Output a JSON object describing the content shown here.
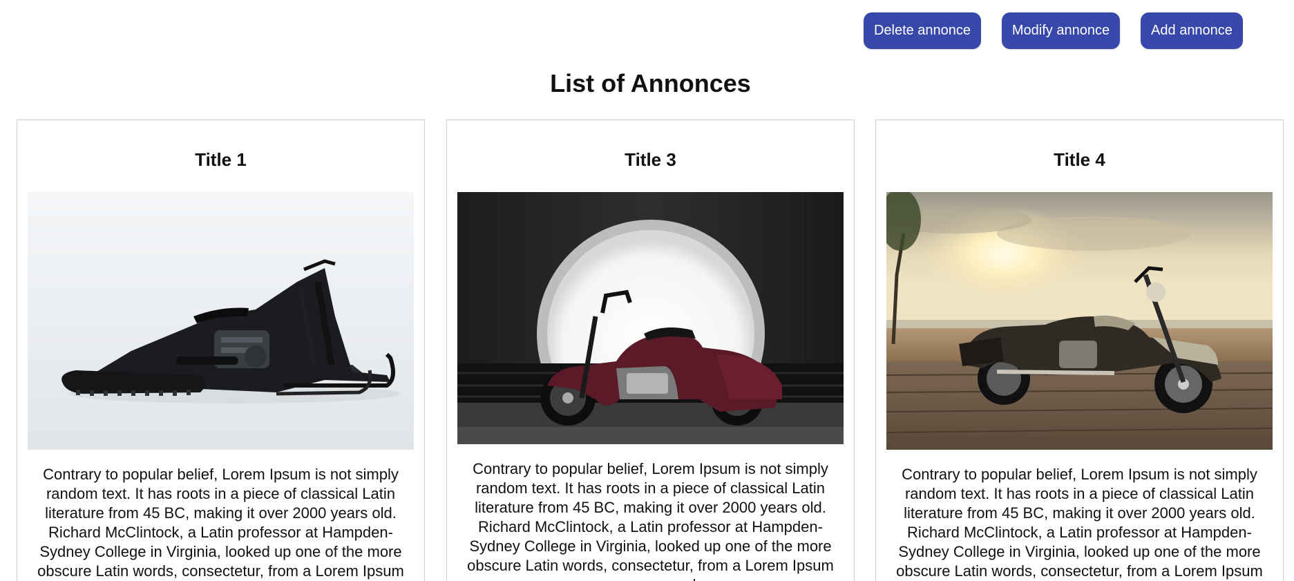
{
  "toolbar": {
    "delete_label": "Delete annonce",
    "modify_label": "Modify annonce",
    "add_label": "Add annonce"
  },
  "page": {
    "title": "List of Annonces"
  },
  "annonces": [
    {
      "title": "Title 1",
      "image": "black-snow-motorcycle-photo",
      "description": "Contrary to popular belief, Lorem Ipsum is not simply random text. It has roots in a piece of classical Latin literature from 45 BC, making it over 2000 years old. Richard McClintock, a Latin professor at Hampden-Sydney College in Virginia, looked up one of the more obscure Latin words, consectetur, from a Lorem Ipsum passage, and"
    },
    {
      "title": "Title 3",
      "image": "maroon-touring-motorcycle-arch-photo",
      "description": "Contrary to popular belief, Lorem Ipsum is not simply random text. It has roots in a piece of classical Latin literature from 45 BC, making it over 2000 years old. Richard McClintock, a Latin professor at Hampden-Sydney College in Virginia, looked up one of the more obscure Latin words, consectetur, from a Lorem Ipsum passage, and"
    },
    {
      "title": "Title 4",
      "image": "cruiser-motorcycle-beach-sunset-photo",
      "description": "Contrary to popular belief, Lorem Ipsum is not simply random text. It has roots in a piece of classical Latin literature from 45 BC, making it over 2000 years old. Richard McClintock, a Latin professor at Hampden-Sydney College in Virginia, looked up one of the more obscure Latin words, consectetur, from a Lorem Ipsum passage, and"
    }
  ],
  "colors": {
    "button_bg": "#3848aa",
    "button_text": "#ffffff",
    "card_border": "#cfcfcf"
  }
}
